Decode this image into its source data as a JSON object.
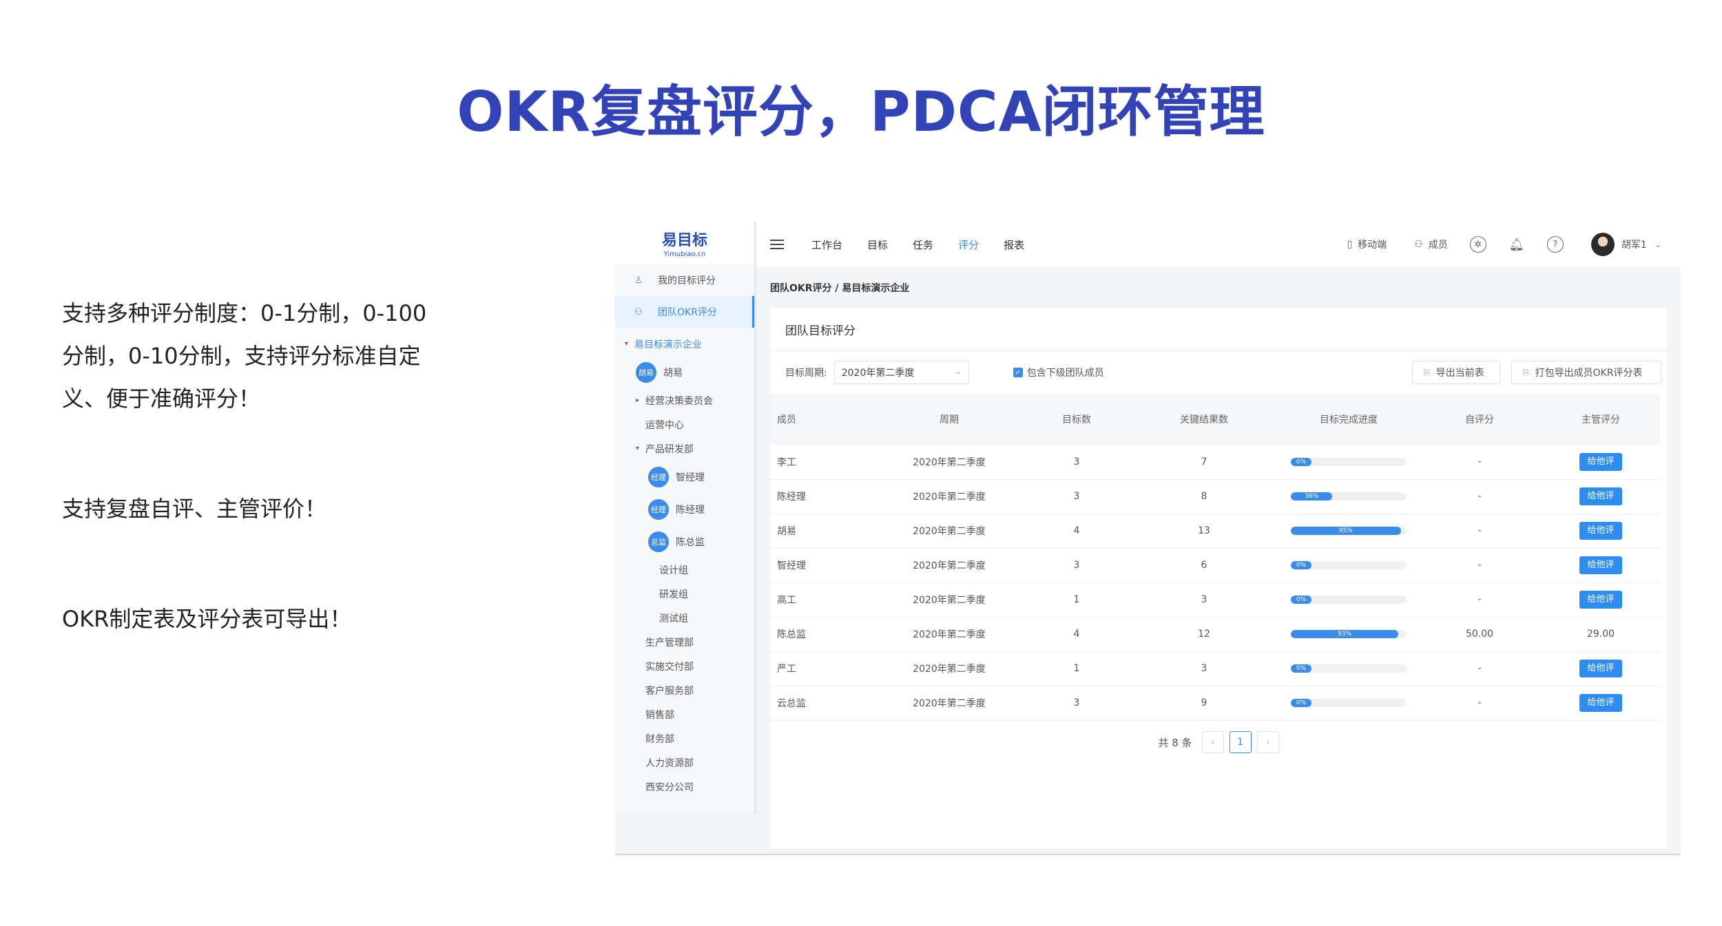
{
  "headline": "OKR复盘评分，PDCA闭环管理",
  "features": [
    "支持多种评分制度：0-1分制，0-100分制，0-10分制，支持评分标准自定义、便于准确评分！",
    "支持复盘自评、主管评价！",
    "OKR制定表及评分表可导出！"
  ],
  "logo": {
    "title": "易目标",
    "sub": "Yimubiao.cn"
  },
  "sidebar": {
    "items": [
      {
        "label": "我的目标评分",
        "icon": "user-icon"
      },
      {
        "label": "团队OKR评分",
        "icon": "team-icon"
      }
    ],
    "tree": {
      "root": "易目标演示企业",
      "hu_avatar": "胡易",
      "hu": "胡易",
      "jingying": "经营决策委员会",
      "yunying": "运营中心",
      "chanpin": "产品研发部",
      "zhi_avatar": "经理",
      "zhi": "智经理",
      "chen_avatar": "经理",
      "chen": "陈经理",
      "zong_avatar": "总监",
      "zong": "陈总监",
      "sheji": "设计组",
      "yanfa": "研发组",
      "ceshi": "测试组",
      "shengchan": "生产管理部",
      "shishi": "实施交付部",
      "kehu": "客户服务部",
      "xiaoshou": "销售部",
      "caiwu": "财务部",
      "renli": "人力资源部",
      "xian": "西安分公司"
    }
  },
  "topbar": {
    "nav": [
      "工作台",
      "目标",
      "任务",
      "评分",
      "报表"
    ],
    "active_nav": "评分",
    "mobile": "移动端",
    "members": "成员",
    "user": "胡军1"
  },
  "breadcrumb": "团队OKR评分 / 易目标演示企业",
  "panel": {
    "title": "团队目标评分",
    "period_label": "目标周期:",
    "period_value": "2020年第二季度",
    "include_sub": "包含下级团队成员",
    "export_current": "导出当前表",
    "export_pack": "打包导出成员OKR评分表"
  },
  "table": {
    "headers": [
      "成员",
      "周期",
      "目标数",
      "关键结果数",
      "目标完成进度",
      "自评分",
      "主管评分"
    ],
    "rows": [
      {
        "member": "李工",
        "period": "2020年第二季度",
        "goals": "3",
        "krs": "7",
        "progress": 0,
        "progress_label": "0%",
        "self": "-",
        "boss": "给他评",
        "boss_is_button": true
      },
      {
        "member": "陈经理",
        "period": "2020年第二季度",
        "goals": "3",
        "krs": "8",
        "progress": 36,
        "progress_label": "36%",
        "self": "-",
        "boss": "给他评",
        "boss_is_button": true
      },
      {
        "member": "胡易",
        "period": "2020年第二季度",
        "goals": "4",
        "krs": "13",
        "progress": 95,
        "progress_label": "95%",
        "self": "-",
        "boss": "给他评",
        "boss_is_button": true
      },
      {
        "member": "智经理",
        "period": "2020年第二季度",
        "goals": "3",
        "krs": "6",
        "progress": 0,
        "progress_label": "0%",
        "self": "-",
        "boss": "给他评",
        "boss_is_button": true
      },
      {
        "member": "高工",
        "period": "2020年第二季度",
        "goals": "1",
        "krs": "3",
        "progress": 0,
        "progress_label": "0%",
        "self": "-",
        "boss": "给他评",
        "boss_is_button": true
      },
      {
        "member": "陈总监",
        "period": "2020年第二季度",
        "goals": "4",
        "krs": "12",
        "progress": 93,
        "progress_label": "93%",
        "self": "50.00",
        "boss": "29.00",
        "boss_is_button": false
      },
      {
        "member": "严工",
        "period": "2020年第二季度",
        "goals": "1",
        "krs": "3",
        "progress": 0,
        "progress_label": "0%",
        "self": "-",
        "boss": "给他评",
        "boss_is_button": true
      },
      {
        "member": "云总监",
        "period": "2020年第二季度",
        "goals": "3",
        "krs": "9",
        "progress": 0,
        "progress_label": "0%",
        "self": "-",
        "boss": "给他评",
        "boss_is_button": true
      }
    ]
  },
  "pager": {
    "total": "共 8 条",
    "current": "1",
    "prev": "‹",
    "next": "›"
  },
  "colors": {
    "accent": "#3b8bea",
    "headline": "#3243b8"
  }
}
